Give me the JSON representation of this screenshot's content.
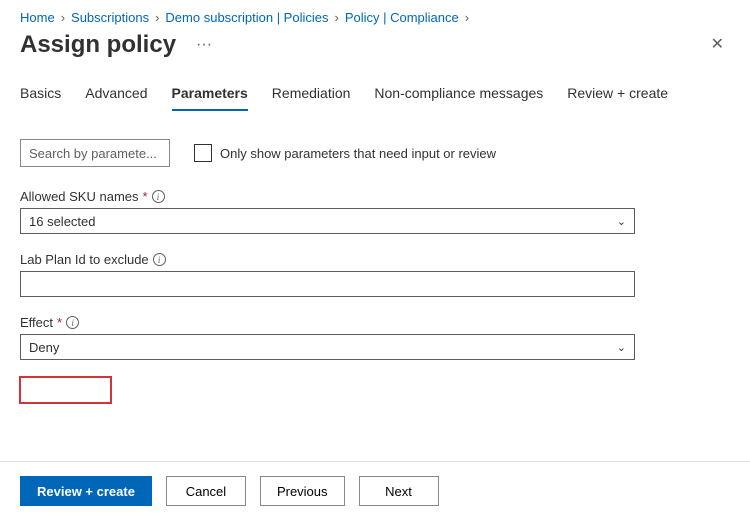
{
  "breadcrumb": {
    "items": [
      {
        "label": "Home"
      },
      {
        "label": "Subscriptions"
      },
      {
        "label": "Demo subscription | Policies"
      },
      {
        "label": "Policy | Compliance"
      }
    ]
  },
  "header": {
    "title": "Assign policy",
    "more_glyph": "···",
    "close_glyph": "✕"
  },
  "tabs": [
    {
      "label": "Basics",
      "active": false
    },
    {
      "label": "Advanced",
      "active": false
    },
    {
      "label": "Parameters",
      "active": true
    },
    {
      "label": "Remediation",
      "active": false
    },
    {
      "label": "Non-compliance messages",
      "active": false
    },
    {
      "label": "Review + create",
      "active": false
    }
  ],
  "filter": {
    "search_placeholder": "Search by paramete...",
    "checkbox_label": "Only show parameters that need input or review",
    "checkbox_checked": false
  },
  "fields": {
    "allowed_sku": {
      "label": "Allowed SKU names",
      "required": true,
      "value": "16 selected"
    },
    "lab_plan": {
      "label": "Lab Plan Id to exclude",
      "required": false,
      "value": ""
    },
    "effect": {
      "label": "Effect",
      "required": true,
      "value": "Deny"
    }
  },
  "footer": {
    "review_create": "Review + create",
    "cancel": "Cancel",
    "previous": "Previous",
    "next": "Next"
  },
  "glyphs": {
    "required": "*",
    "info": "i",
    "chevron": "›",
    "chevron_down": "⌄"
  }
}
